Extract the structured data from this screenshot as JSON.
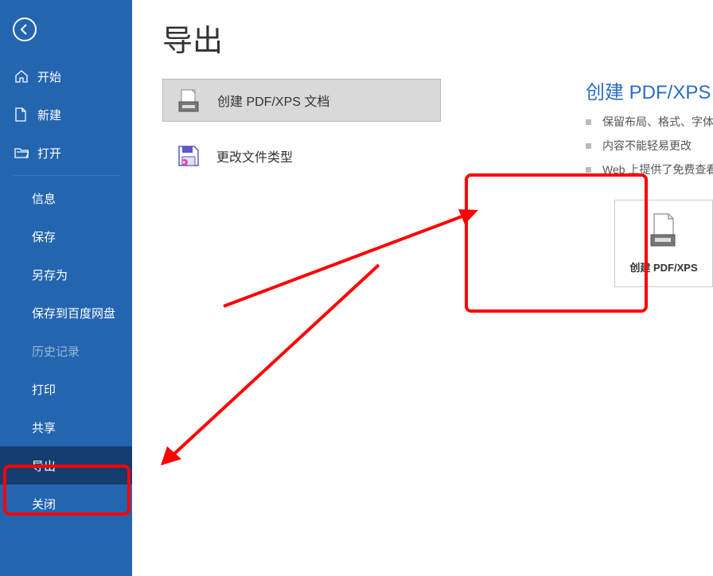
{
  "page_title": "导出",
  "sidebar": {
    "items": [
      {
        "label": "开始",
        "icon": "home"
      },
      {
        "label": "新建",
        "icon": "newfile"
      },
      {
        "label": "打开",
        "icon": "folder"
      }
    ],
    "indent_items": [
      {
        "label": "信息"
      },
      {
        "label": "保存"
      },
      {
        "label": "另存为"
      },
      {
        "label": "保存到百度网盘"
      },
      {
        "label": "历史记录",
        "disabled": true
      },
      {
        "label": "打印"
      },
      {
        "label": "共享"
      },
      {
        "label": "导出",
        "selected": true
      },
      {
        "label": "关闭"
      }
    ]
  },
  "options": [
    {
      "label": "创建 PDF/XPS 文档",
      "icon": "pdf",
      "selected": true
    },
    {
      "label": "更改文件类型",
      "icon": "savetype",
      "selected": false
    }
  ],
  "right_panel": {
    "title": "创建 PDF/XPS 文档",
    "bullets": [
      "保留布局、格式、字体和图像",
      "内容不能轻易更改",
      "Web 上提供了免费查看器"
    ],
    "button_label": "创建 PDF/XPS"
  }
}
